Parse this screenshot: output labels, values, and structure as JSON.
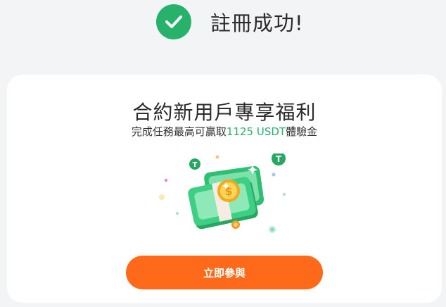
{
  "header": {
    "title": "註冊成功!"
  },
  "promo": {
    "title": "合約新用戶專享福利",
    "subtitle_prefix": "完成任務最高可贏取",
    "subtitle_amount": "1125 USDT",
    "subtitle_suffix": "體驗金"
  },
  "illustration": {
    "coin_symbol": "$",
    "token_symbol": "T"
  },
  "action": {
    "join_label": "立即參與"
  },
  "colors": {
    "success_green": "#27b26c",
    "button_orange": "#ff6a1a"
  }
}
